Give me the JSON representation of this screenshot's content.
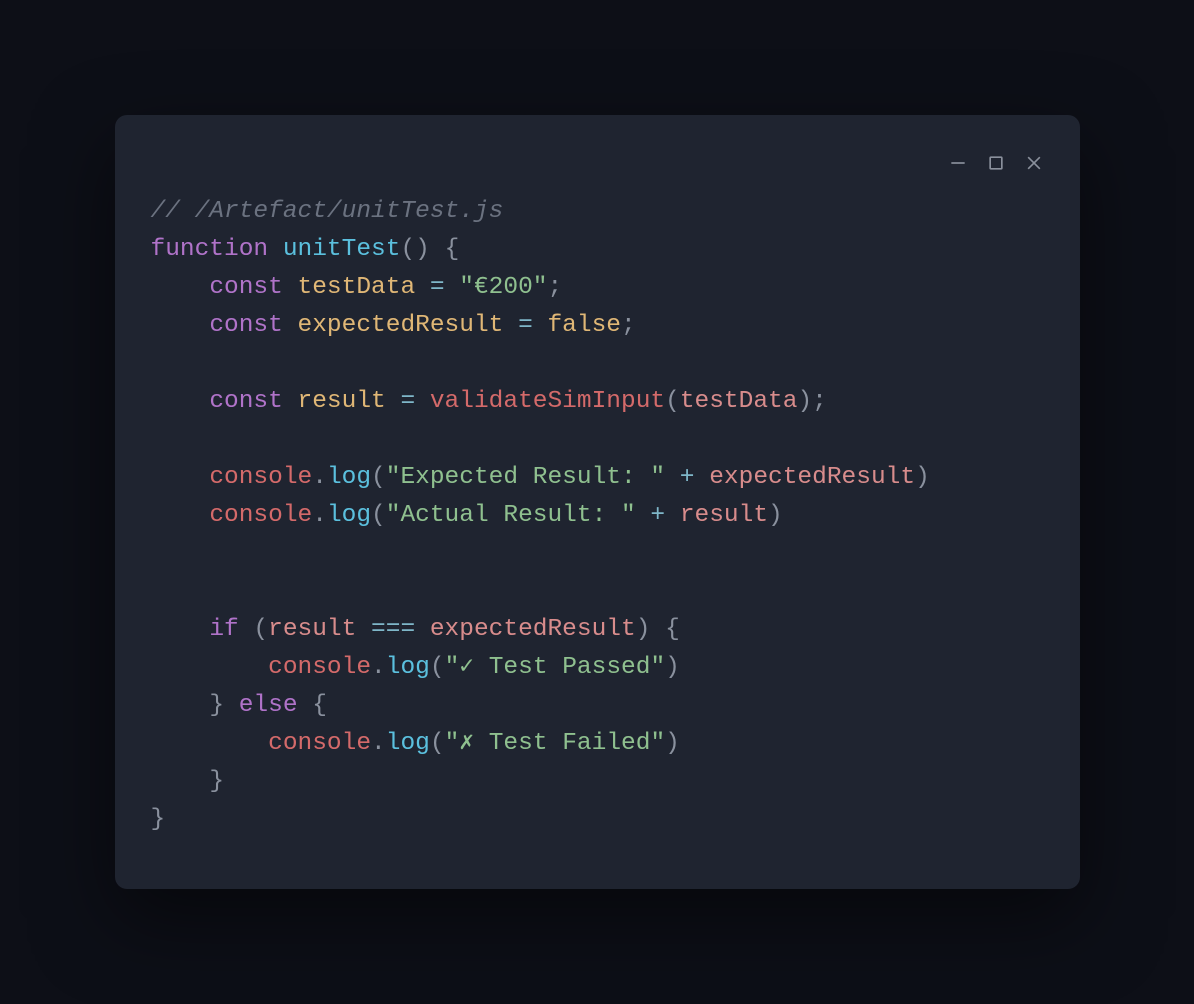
{
  "window": {
    "controls": {
      "minimize": "minimize",
      "maximize": "maximize",
      "close": "close"
    }
  },
  "code": {
    "comment": "// /Artefact/unitTest.js",
    "fn_keyword": "function",
    "fn_name": "unitTest",
    "paren_open": "(",
    "paren_close": ")",
    "space": " ",
    "brace_open": "{",
    "brace_close": "}",
    "indent1": "    ",
    "indent2": "        ",
    "const_kw": "const",
    "var_testData": "testData",
    "eq": " = ",
    "str_testData": "\"€200\"",
    "semi": ";",
    "var_expectedResult": "expectedResult",
    "val_false": "false",
    "var_result": "result",
    "fn_validateSimInput": "validateSimInput",
    "arg_testData": "testData",
    "obj_console": "console",
    "dot": ".",
    "method_log": "log",
    "str_expected": "\"Expected Result: \"",
    "plus": " + ",
    "ref_expectedResult": "expectedResult",
    "str_actual": "\"Actual Result: \"",
    "ref_result": "result",
    "if_kw": "if",
    "sp_paren_open": " (",
    "triple_eq": " === ",
    "str_pass": "\"✓ Test Passed\"",
    "else_kw": "else",
    "str_fail": "\"✗ Test Failed\""
  }
}
